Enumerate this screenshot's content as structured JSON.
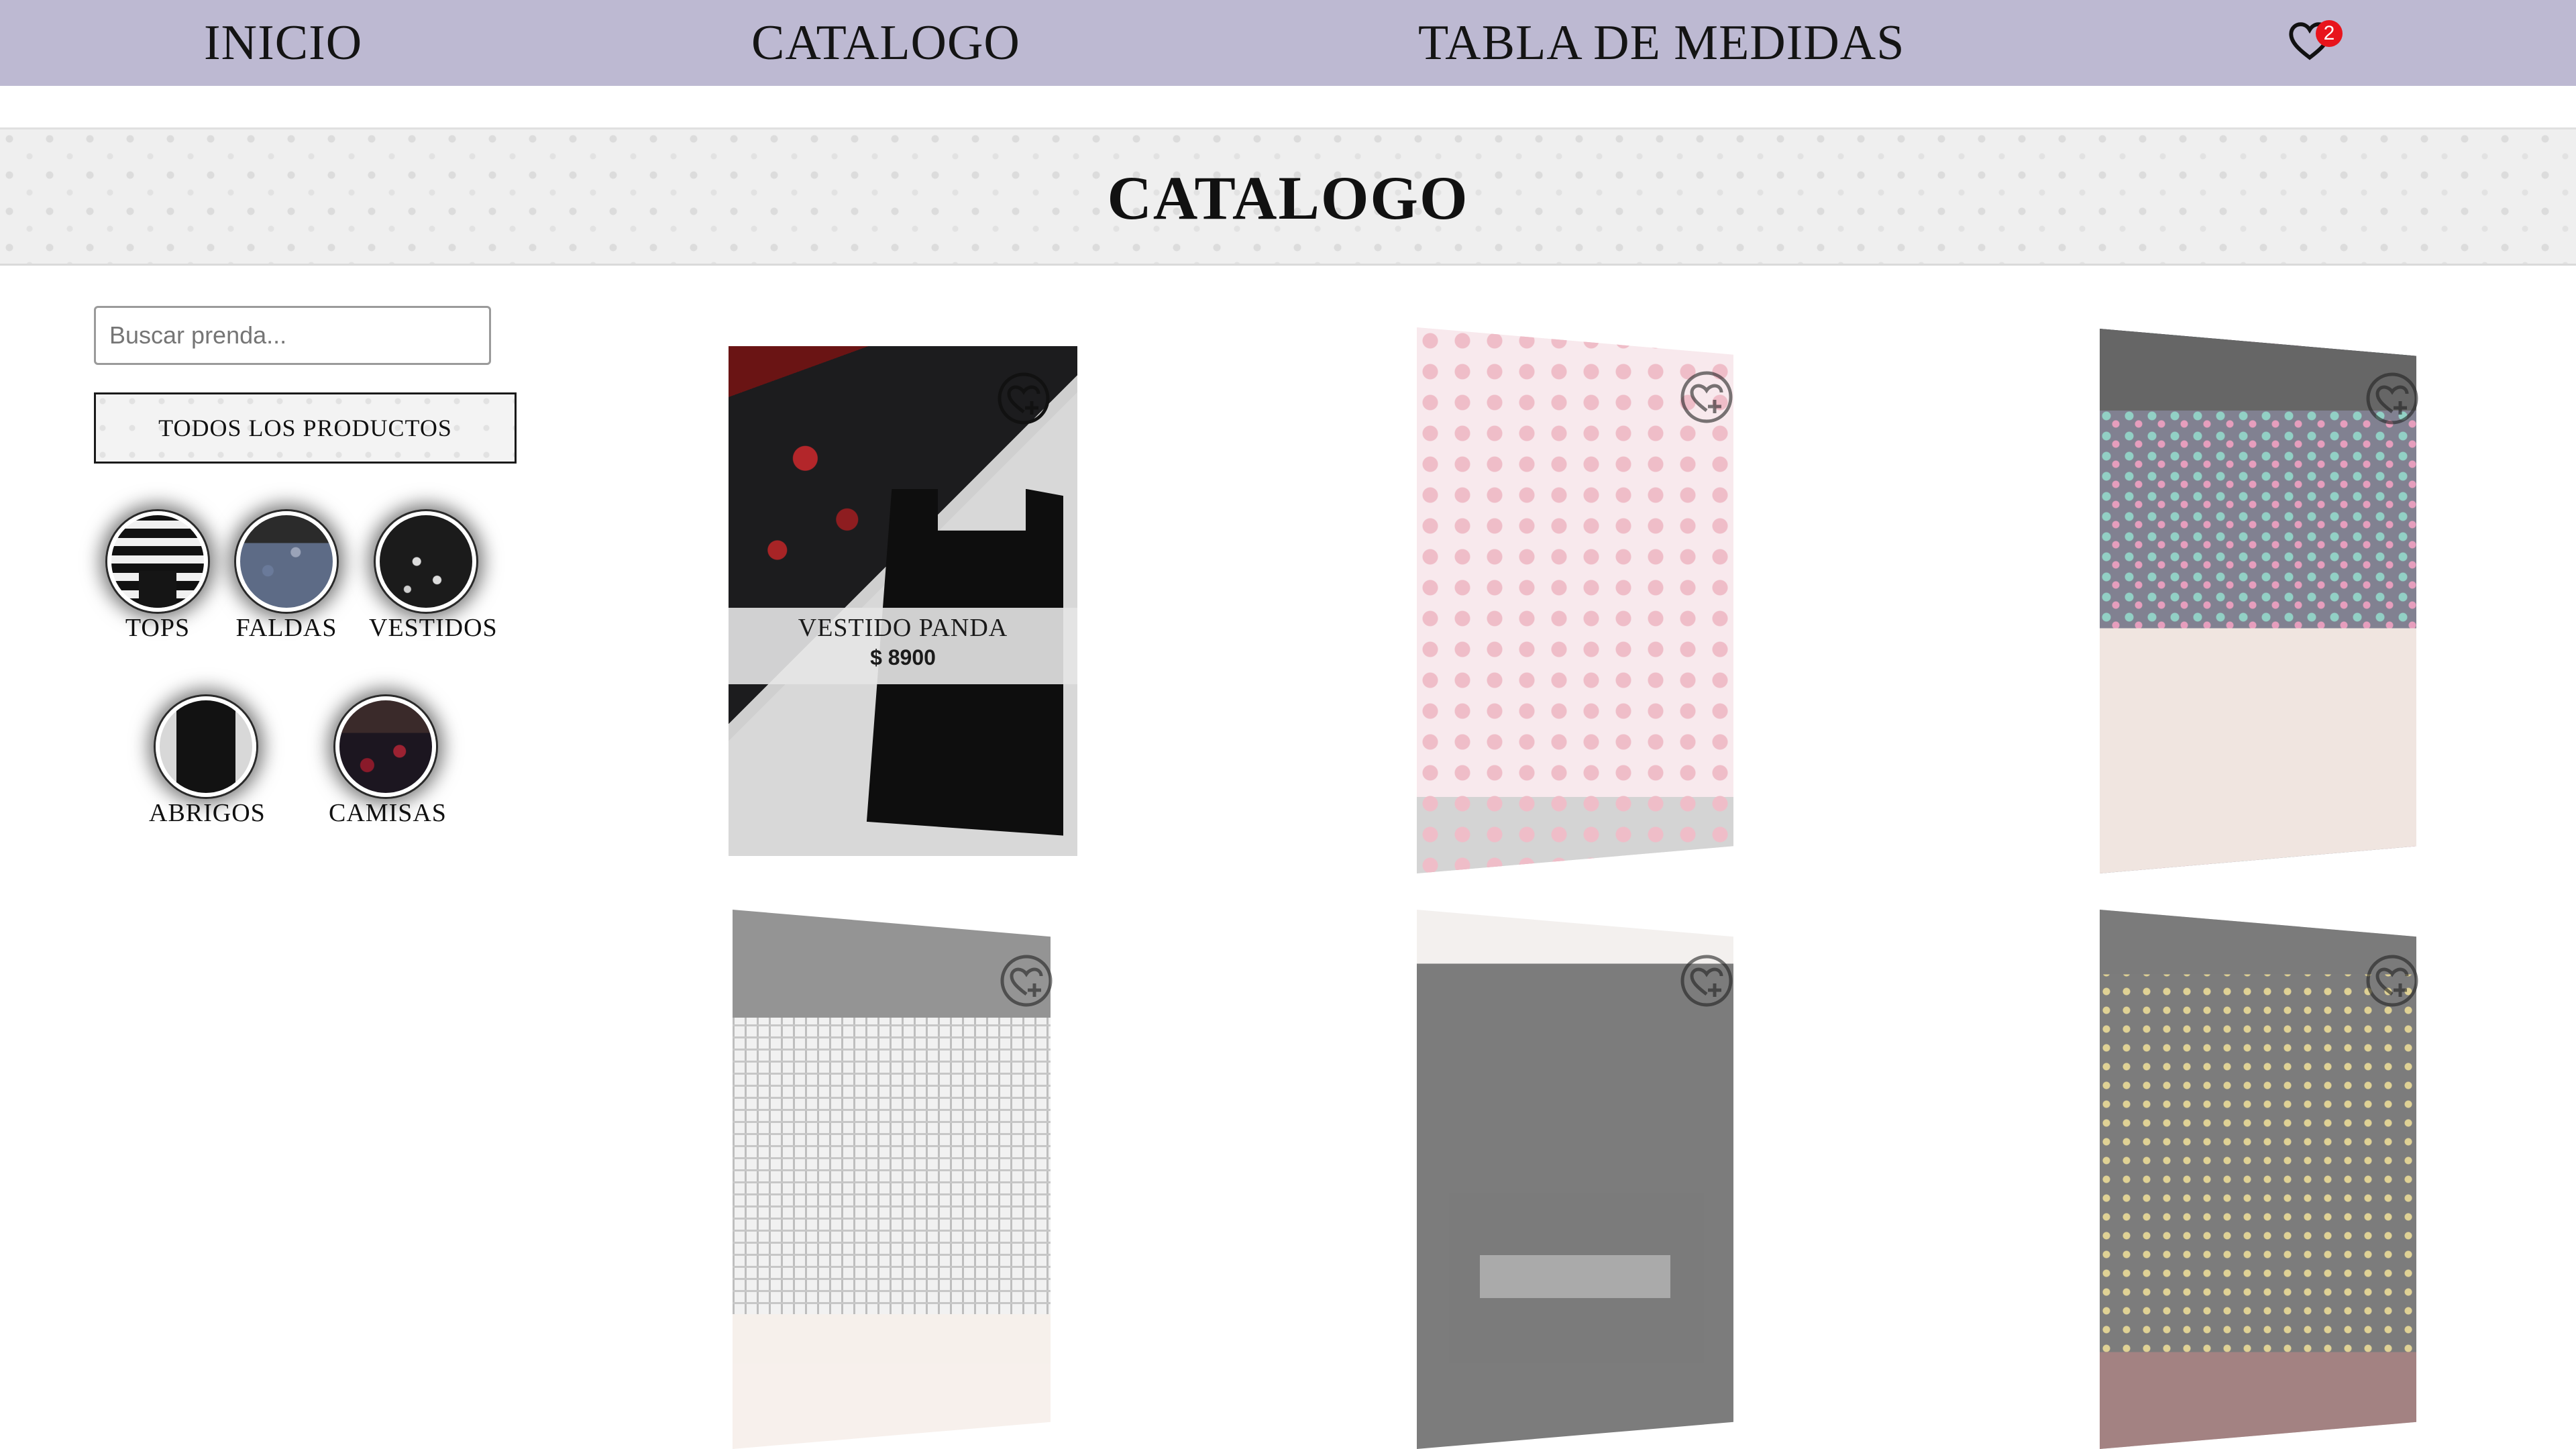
{
  "nav": {
    "inicio": "INICIO",
    "catalogo": "CATALOGO",
    "medidas": "TABLA DE MEDIDAS",
    "favorites_count": "2"
  },
  "banner": {
    "title": "CATALOGO"
  },
  "sidebar": {
    "search_placeholder": "Buscar prenda...",
    "all_products_label": "TODOS LOS PRODUCTOS",
    "categories": [
      {
        "label": "TOPS"
      },
      {
        "label": "FALDAS"
      },
      {
        "label": "VESTIDOS"
      },
      {
        "label": "ABRIGOS"
      },
      {
        "label": "CAMISAS"
      }
    ]
  },
  "products": [
    {
      "name": "VESTIDO PANDA",
      "price": "$ 8900"
    }
  ],
  "colors": {
    "nav_bg": "#bdb9d2",
    "badge": "#e8141c"
  }
}
